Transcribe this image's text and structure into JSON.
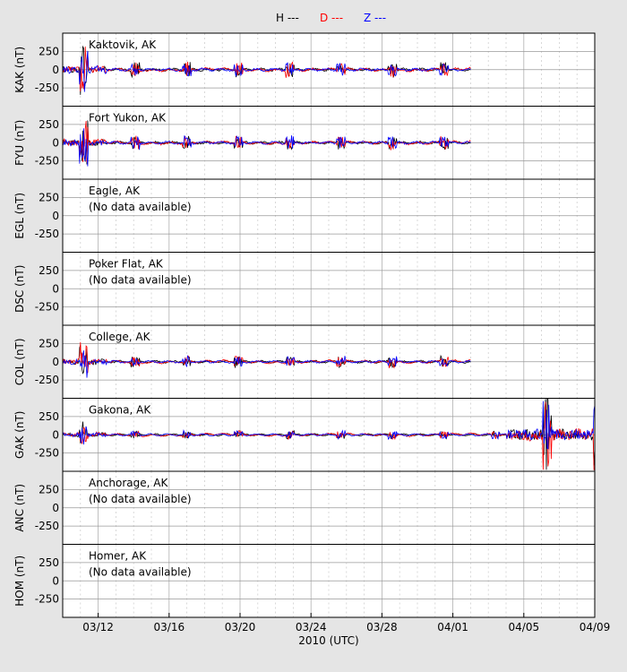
{
  "chart_data": {
    "type": "line",
    "title": "",
    "xlabel": "2010 (UTC)",
    "x_ticks": [
      "03/12",
      "03/16",
      "03/20",
      "03/24",
      "03/28",
      "04/01",
      "04/05",
      "04/09"
    ],
    "xlim": [
      "2010-03-10",
      "2010-04-09"
    ],
    "ylim": [
      -500,
      500
    ],
    "y_ticks": [
      250,
      0,
      -250
    ],
    "grid": true,
    "legend": [
      {
        "name": "H ---",
        "color": "#000000"
      },
      {
        "name": "D ---",
        "color": "#ff0000"
      },
      {
        "name": "Z ---",
        "color": "#0000ff"
      }
    ],
    "panels": [
      {
        "code": "KAK (nT)",
        "station": "Kaktovik, AK",
        "note": "",
        "data_end": "2010-04-02",
        "activity": 1.0
      },
      {
        "code": "FYU (nT)",
        "station": "Fort Yukon, AK",
        "note": "",
        "data_end": "2010-04-02",
        "activity": 0.9
      },
      {
        "code": "EGL (nT)",
        "station": "Eagle, AK",
        "note": "(No data available)",
        "data_end": null,
        "activity": 0
      },
      {
        "code": "DSC (nT)",
        "station": "Poker Flat, AK",
        "note": "(No data available)",
        "data_end": null,
        "activity": 0
      },
      {
        "code": "COL (nT)",
        "station": "College, AK",
        "note": "",
        "data_end": "2010-04-02",
        "activity": 0.75
      },
      {
        "code": "GAK (nT)",
        "station": "Gakona, AK",
        "note": "",
        "data_end": "2010-04-09",
        "activity": 0.5
      },
      {
        "code": "ANC (nT)",
        "station": "Anchorage, AK",
        "note": "(No data available)",
        "data_end": null,
        "activity": 0
      },
      {
        "code": "HOM (nT)",
        "station": "Homer, AK",
        "note": "(No data available)",
        "data_end": null,
        "activity": 0
      }
    ]
  }
}
